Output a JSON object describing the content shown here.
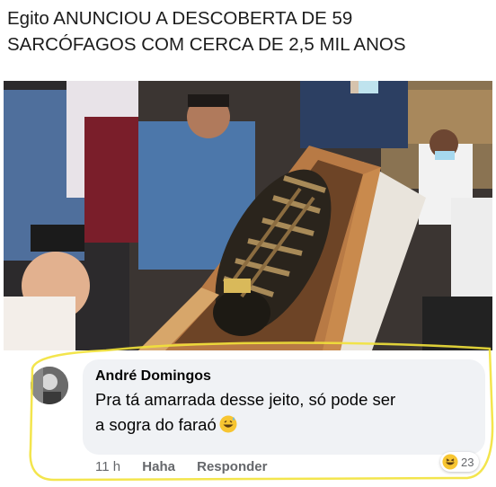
{
  "headline": {
    "line1": "Egito ANUNCIOU A DESCOBERTA DE 59",
    "line2": "SARCÓFAGOS COM CERCA DE 2,5 MIL ANOS"
  },
  "comment": {
    "author": "André Domingos",
    "text_line1": "Pra tá amarrada desse jeito, só pode ser",
    "text_line2": "a sogra do faraó",
    "text_emoji": "grinning-sweat-emoji",
    "time": "11 h",
    "reaction_action": "Haha",
    "reply_action": "Responder",
    "reaction_count": "23",
    "reaction_icon": "haha-emoji"
  },
  "colors": {
    "bubble": "#f0f2f5",
    "highlight_marker": "#f2e23a",
    "action_text": "#65676b"
  }
}
